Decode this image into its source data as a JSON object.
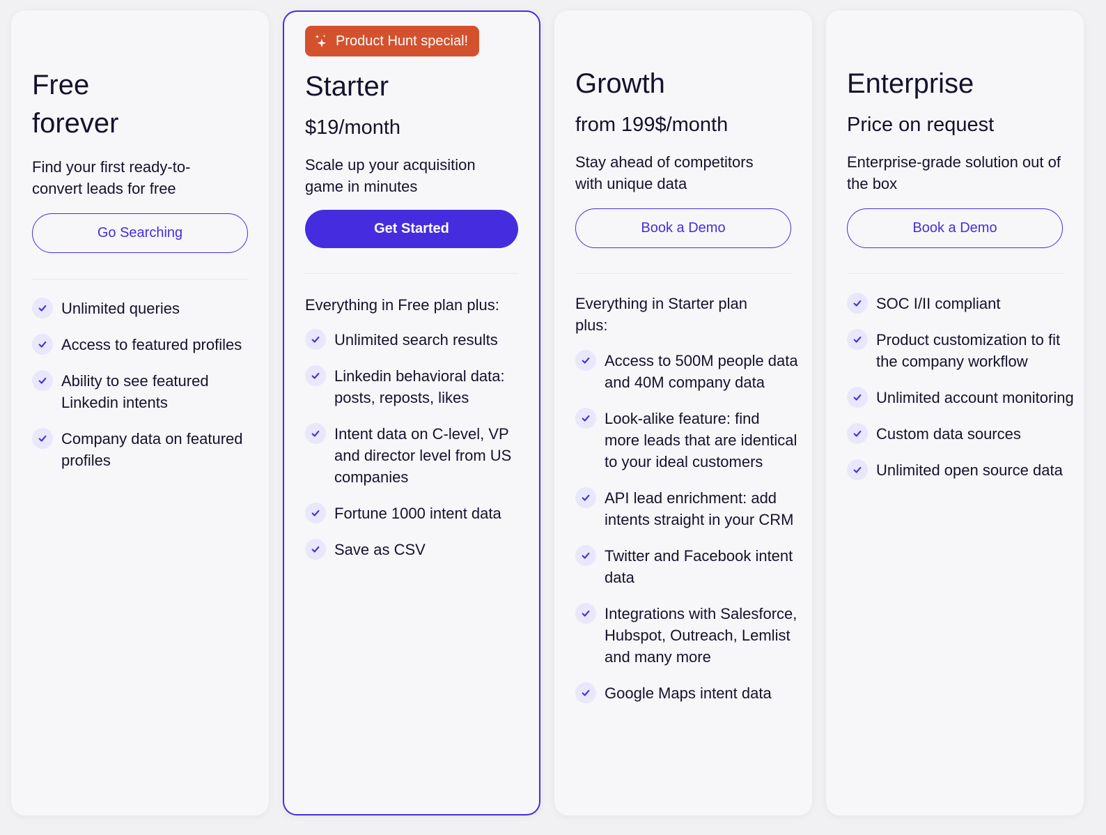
{
  "colors": {
    "accent": "#452ddf",
    "badge": "#d4512e",
    "card_bg": "#f7f7fa",
    "page_bg": "#f1f1f4",
    "check_bg": "#e9e7fc",
    "text": "#14122b"
  },
  "plans": [
    {
      "title_line1": "Free",
      "title_line2": "forever",
      "description": "Find your first ready-to-convert leads for free",
      "button": "Go Searching",
      "features": [
        "Unlimited queries",
        "Access to featured profiles",
        "Ability to see featured Linkedin intents",
        "Company data on featured profiles"
      ]
    },
    {
      "badge": "Product Hunt special!",
      "badge_icon": "sparkles-icon",
      "title": "Starter",
      "price": "$19/month",
      "description": "Scale up your acquisition game in minutes",
      "button": "Get Started",
      "intro": "Everything in Free plan plus:",
      "features": [
        "Unlimited search results",
        "Linkedin behavioral data: posts, reposts, likes",
        "Intent data on C-level, VP and director level from US companies",
        "Fortune 1000 intent data",
        "Save as CSV"
      ]
    },
    {
      "title": "Growth",
      "price": "from 199$/month",
      "description": "Stay ahead of competitors with unique data",
      "button": "Book a Demo",
      "intro": "Everything in Starter plan plus:",
      "features": [
        "Access to 500M people data and 40M company data",
        "Look-alike feature: find more leads that are identical to your ideal customers",
        "API lead enrichment: add intents straight in your CRM",
        "Twitter and Facebook intent data",
        "Integrations with Salesforce, Hubspot, Outreach, Lemlist and many more",
        "Google Maps intent data"
      ]
    },
    {
      "title": "Enterprise",
      "price": "Price on request",
      "description": "Enterprise-grade solution out of the box",
      "button": "Book a Demo",
      "features": [
        "SOC I/II compliant",
        "Product customization to fit the company workflow",
        "Unlimited account monitoring",
        "Custom data sources",
        "Unlimited open source data"
      ]
    }
  ]
}
